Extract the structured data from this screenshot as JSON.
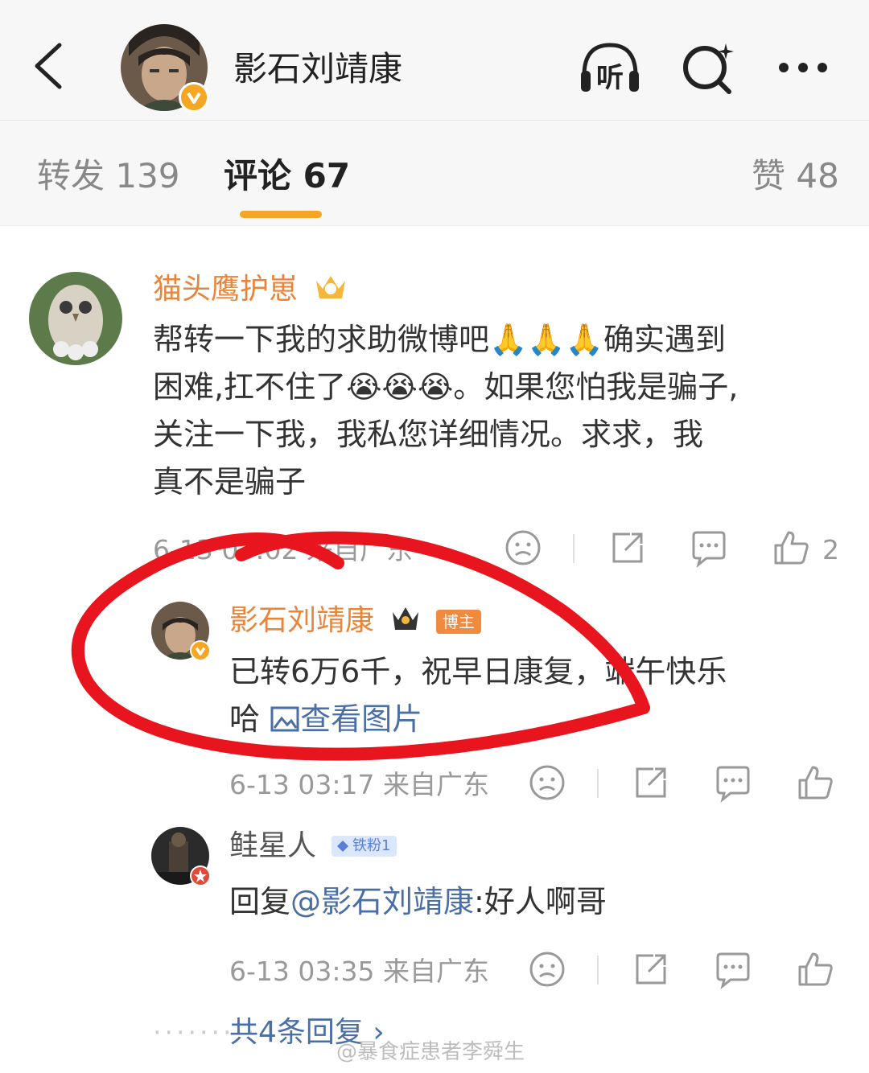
{
  "header": {
    "title": "影石刘靖康",
    "listen_label": "听"
  },
  "tabs": [
    {
      "label": "转发 139"
    },
    {
      "label": "评论 67"
    },
    {
      "label": "赞 48"
    }
  ],
  "comment": {
    "username": "猫头鹰护崽",
    "text_lines": [
      "帮转一下我的求助微博吧🙏🙏🙏确实遇到",
      "困难,扛不住了😭😭😭。如果您怕我是骗子,",
      "关注一下我，我私您详细情况。求求，我",
      "真不是骗子"
    ],
    "time": "6-13 03:02 来自广东",
    "like_count": "2",
    "replies": [
      {
        "username": "影石刘靖康",
        "badge": "博主",
        "text_lines": [
          "已转6万6千，祝早日康复，端午快乐",
          "哈 "
        ],
        "image_link": "查看图片",
        "time": "6-13 03:17  来自广东"
      },
      {
        "username": "鲑星人",
        "badge": "铁粉1",
        "text_prefix": "回复",
        "mention": "@影石刘靖康",
        "text_suffix": ":好人啊哥",
        "time": "6-13 03:35  来自广东"
      }
    ],
    "more_replies": "共4条回复 ›"
  },
  "watermark": "@暴食症患者李舜生",
  "colors": {
    "accent": "#f5a623",
    "username": "#e8853b",
    "link": "#4a6fa5",
    "annotation": "#e8141e"
  }
}
